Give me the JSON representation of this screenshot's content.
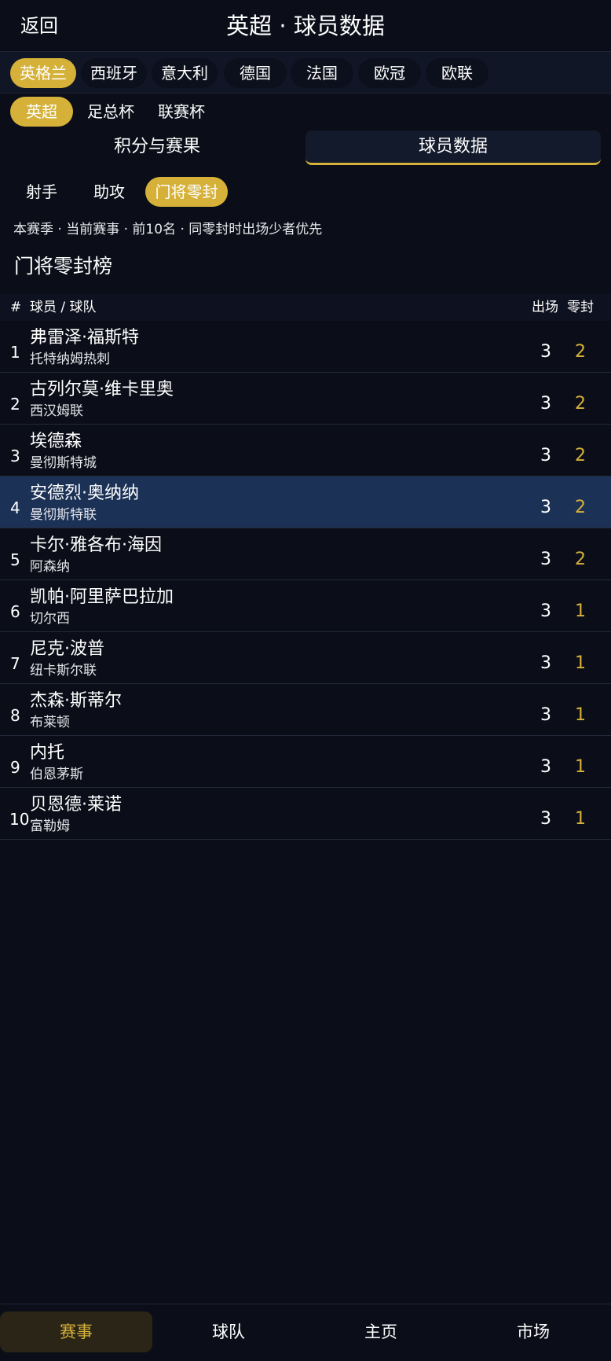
{
  "header": {
    "back_label": "返回",
    "title": "英超 · 球员数据"
  },
  "countries": [
    "英格兰",
    "西班牙",
    "意大利",
    "德国",
    "法国",
    "欧冠",
    "欧联"
  ],
  "competitions": [
    "英超",
    "足总杯",
    "联赛杯"
  ],
  "view_tabs": [
    "积分与赛果",
    "球员数据"
  ],
  "stat_tabs": [
    "射手",
    "助攻",
    "门将零封"
  ],
  "note": "本赛季 · 当前赛事 · 前10名 · 同零封时出场少者优先",
  "section_title": "门将零封榜",
  "table": {
    "headers": {
      "rank": "#",
      "player": "球员 / 球队",
      "apps": "出场",
      "clean_sheets": "零封"
    },
    "rows": [
      {
        "rank": "1",
        "name": "弗雷泽·福斯特",
        "team": "托特纳姆热刺",
        "apps": "3",
        "cs": "2"
      },
      {
        "rank": "2",
        "name": "古列尔莫·维卡里奥",
        "team": "西汉姆联",
        "apps": "3",
        "cs": "2"
      },
      {
        "rank": "3",
        "name": "埃德森",
        "team": "曼彻斯特城",
        "apps": "3",
        "cs": "2"
      },
      {
        "rank": "4",
        "name": "安德烈·奥纳纳",
        "team": "曼彻斯特联",
        "apps": "3",
        "cs": "2"
      },
      {
        "rank": "5",
        "name": "卡尔·雅各布·海因",
        "team": "阿森纳",
        "apps": "3",
        "cs": "2"
      },
      {
        "rank": "6",
        "name": "凯帕·阿里萨巴拉加",
        "team": "切尔西",
        "apps": "3",
        "cs": "1"
      },
      {
        "rank": "7",
        "name": "尼克·波普",
        "team": "纽卡斯尔联",
        "apps": "3",
        "cs": "1"
      },
      {
        "rank": "8",
        "name": "杰森·斯蒂尔",
        "team": "布莱顿",
        "apps": "3",
        "cs": "1"
      },
      {
        "rank": "9",
        "name": "内托",
        "team": "伯恩茅斯",
        "apps": "3",
        "cs": "1"
      },
      {
        "rank": "10",
        "name": "贝恩德·莱诺",
        "team": "富勒姆",
        "apps": "3",
        "cs": "1"
      }
    ]
  },
  "bottom_nav": [
    "赛事",
    "球队",
    "主页",
    "市场"
  ],
  "colors": {
    "accent": "#d6b13a",
    "background": "#0b0e18",
    "highlight_row": "#1b3156"
  }
}
